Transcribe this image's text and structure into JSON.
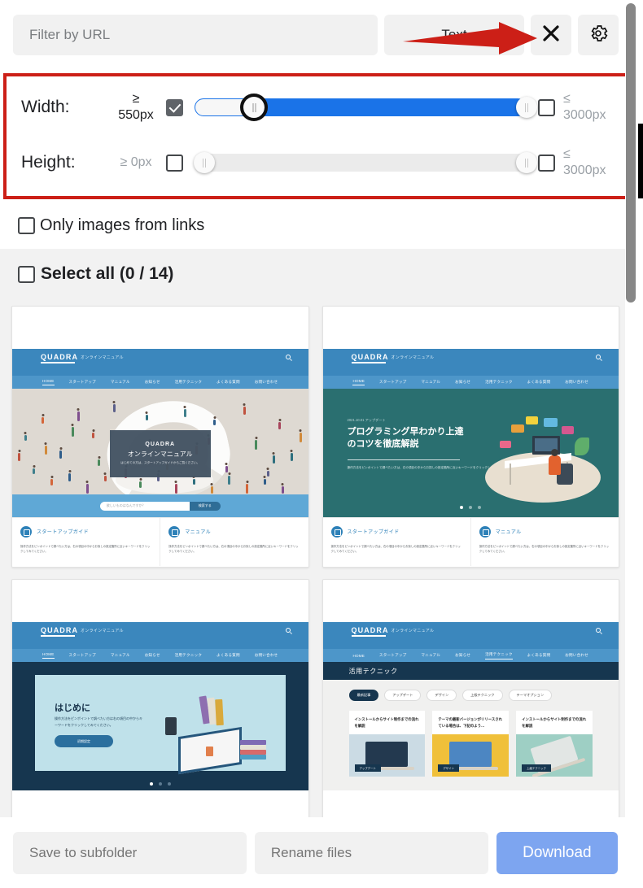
{
  "toolbar": {
    "url_filter_placeholder": "Filter by URL",
    "url_filter_value": "",
    "text_button_label": "Text",
    "close_icon": "close-icon",
    "settings_icon": "gear-icon"
  },
  "size_filters": {
    "highlight_color": "#cc1f17",
    "width": {
      "label": "Width:",
      "min_op": "≥",
      "min_value": "550px",
      "min_enabled": true,
      "max_op": "≤",
      "max_value": "3000px",
      "max_enabled": false,
      "slider_fill_color": "#1a73e8",
      "left_knob_percent": 18,
      "right_knob_percent": 100
    },
    "height": {
      "label": "Height:",
      "min_op": "≥",
      "min_value": "0px",
      "min_enabled": false,
      "max_op": "≤",
      "max_value": "3000px",
      "max_enabled": false,
      "left_knob_percent": 3,
      "right_knob_percent": 100
    }
  },
  "options": {
    "only_images_from_links_label": "Only images from links",
    "only_images_from_links_checked": false
  },
  "select_all": {
    "label": "Select all (0 / 14)",
    "checked": false,
    "selected_count": 0,
    "total_count": 14
  },
  "site": {
    "brand": "QUADRA",
    "brand_sub": "オンラインマニュアル",
    "nav": [
      "HOME",
      "スタートアップ",
      "マニュアル",
      "お知らせ",
      "活用テクニック",
      "よくある質問",
      "お問い合わせ"
    ],
    "search_icon": "search-icon",
    "card_a_title": "スタートアップガイド",
    "card_b_title": "マニュアル",
    "card_body": "操作方法をピンポイントで調べたい方は、右の項目の中からお探しの設定箇所に近いキーワードをクリックしてみてください。"
  },
  "thumbnails": [
    {
      "id": 1,
      "kind": "hero-crowd",
      "selected": false,
      "hero_brand": "QUADRA",
      "hero_title": "オンラインマニュアル",
      "hero_sub": "はじめての方は、スタートアップガイドからご覧ください。",
      "search_placeholder": "欲しいものはなんですか？",
      "search_button": "検索する"
    },
    {
      "id": 2,
      "kind": "hero-teal",
      "selected": false,
      "kicker": "2021.10.01 アップデート",
      "title_line1": "プログラミング早わかり上達",
      "title_line2": "のコツを徹底解説",
      "sub": "操作方法をピンポイントで調べたい方は、右の項目の中からお探しの設定箇所に近いキーワードをクリックしてみてください。"
    },
    {
      "id": 3,
      "kind": "hero-navy",
      "selected": false,
      "title": "はじめに",
      "sub": "操作方法をピンポイントで調べたい方は右の項目の中からキーワードをクリックしてみてください。",
      "button": "初期設定"
    },
    {
      "id": 4,
      "kind": "list-page",
      "selected": false,
      "page_title": "活用テクニック",
      "chips": [
        "最新記事",
        "アップデート",
        "デザイン",
        "上級テクニック",
        "テーマオプション"
      ],
      "tiles": [
        {
          "text": "インストールからサイト制作までの流れを解説",
          "tag": "アップデート"
        },
        {
          "text": "テーマの最新バージョンがリリースされている場合は、下記のよう…",
          "tag": "デザイン"
        },
        {
          "text": "インストールからサイト制作までの流れを解説",
          "tag": "上級テクニック"
        }
      ]
    }
  ],
  "actions": {
    "save_subfolder_placeholder": "Save to subfolder",
    "rename_files_placeholder": "Rename files",
    "download_label": "Download",
    "download_color": "#7da5f0"
  }
}
